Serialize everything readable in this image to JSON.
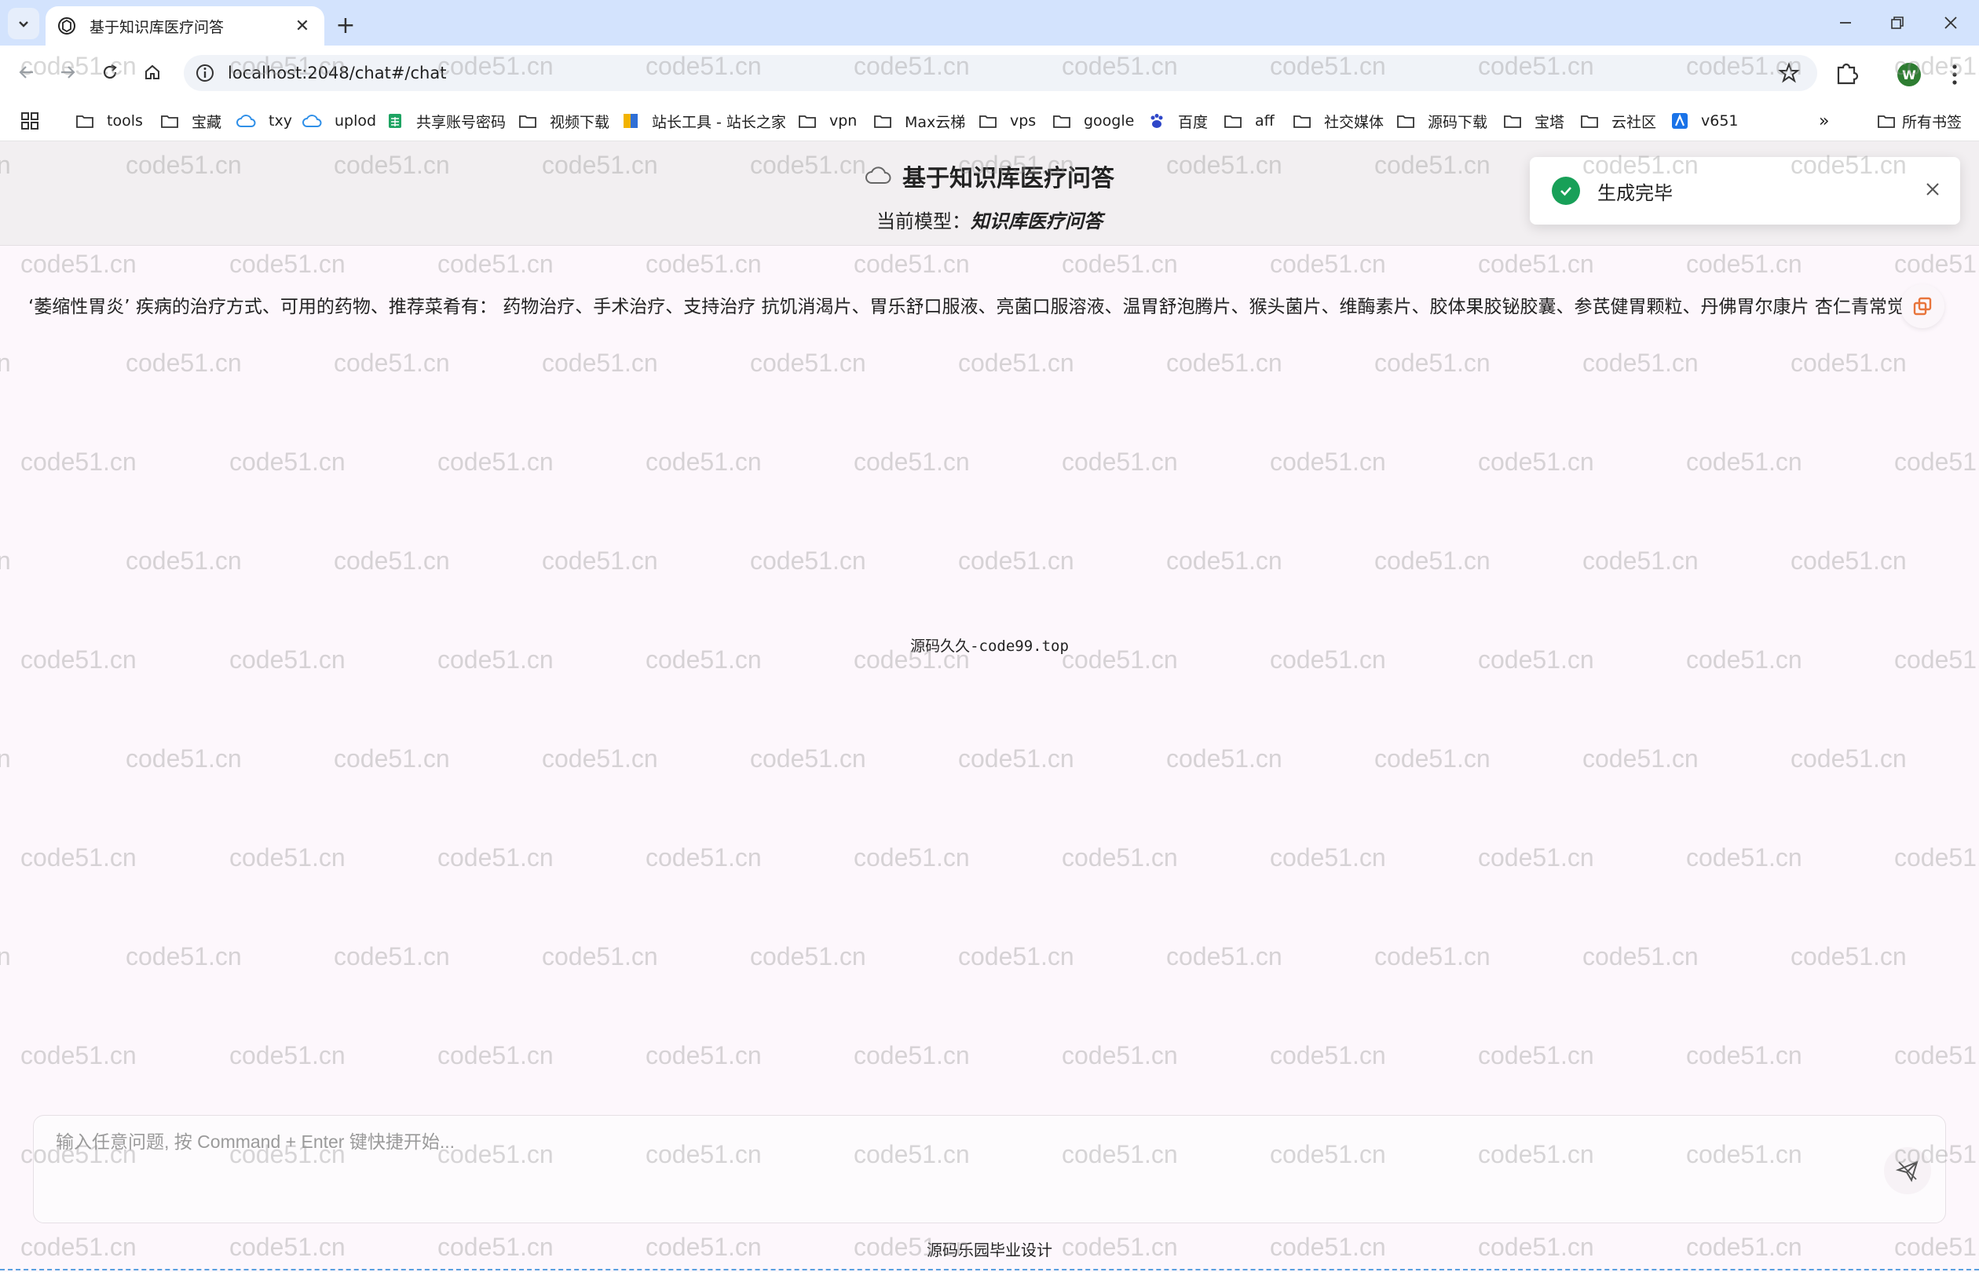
{
  "browser": {
    "tab_title": "基于知识库医疗问答",
    "url": "localhost:2048/chat#/chat",
    "profile_initial": "W",
    "bookmarks": [
      {
        "label": "tools",
        "icon": "folder-icon"
      },
      {
        "label": "宝藏",
        "icon": "folder-icon"
      },
      {
        "label": "txy",
        "icon": "cloud-icon"
      },
      {
        "label": "uplod",
        "icon": "cloud-icon"
      },
      {
        "label": "共享账号密码",
        "icon": "sheet-icon"
      },
      {
        "label": "视频下载",
        "icon": "folder-icon"
      },
      {
        "label": "站长工具 - 站长之家",
        "icon": "site-icon"
      },
      {
        "label": "vpn",
        "icon": "folder-icon"
      },
      {
        "label": "Max云梯",
        "icon": "folder-icon"
      },
      {
        "label": "vps",
        "icon": "folder-icon"
      },
      {
        "label": "google",
        "icon": "folder-icon"
      },
      {
        "label": "百度",
        "icon": "baidu-icon"
      },
      {
        "label": "aff",
        "icon": "folder-icon"
      },
      {
        "label": "社交媒体",
        "icon": "folder-icon"
      },
      {
        "label": "源码下载",
        "icon": "folder-icon"
      },
      {
        "label": "宝塔",
        "icon": "folder-icon"
      },
      {
        "label": "云社区",
        "icon": "folder-icon"
      },
      {
        "label": "v651",
        "icon": "v-icon"
      }
    ],
    "all_bookmarks_label": "所有书签"
  },
  "header": {
    "title": "基于知识库医疗问答",
    "model_prefix": "当前模型：",
    "model_name": "知识库医疗问答"
  },
  "toast": {
    "message": "生成完毕",
    "status_color": "#18a058"
  },
  "chat": {
    "answer": "‘萎缩性胃炎’ 疾病的治疗方式、可用的药物、推荐菜肴有： 药物治疗、手术治疗、支持治疗 抗饥消渴片、胃乐舒口服液、亮菌口服溶液、温胃舒泡腾片、猴头菌片、维酶素片、胶体果胶铋胶囊、参芪健胃颗粒、丹佛胃尔康片 杏仁青常觉"
  },
  "center_mark": "源码久久-code99.top",
  "input": {
    "placeholder": "输入任意问题, 按 Command + Enter 键快捷开始..."
  },
  "footer": "源码乐园毕业设计",
  "watermark": "code51.cn",
  "colors": {
    "accent": "#18a058",
    "copy_icon": "#e8743b",
    "tabstrip": "#d3e3fd"
  }
}
